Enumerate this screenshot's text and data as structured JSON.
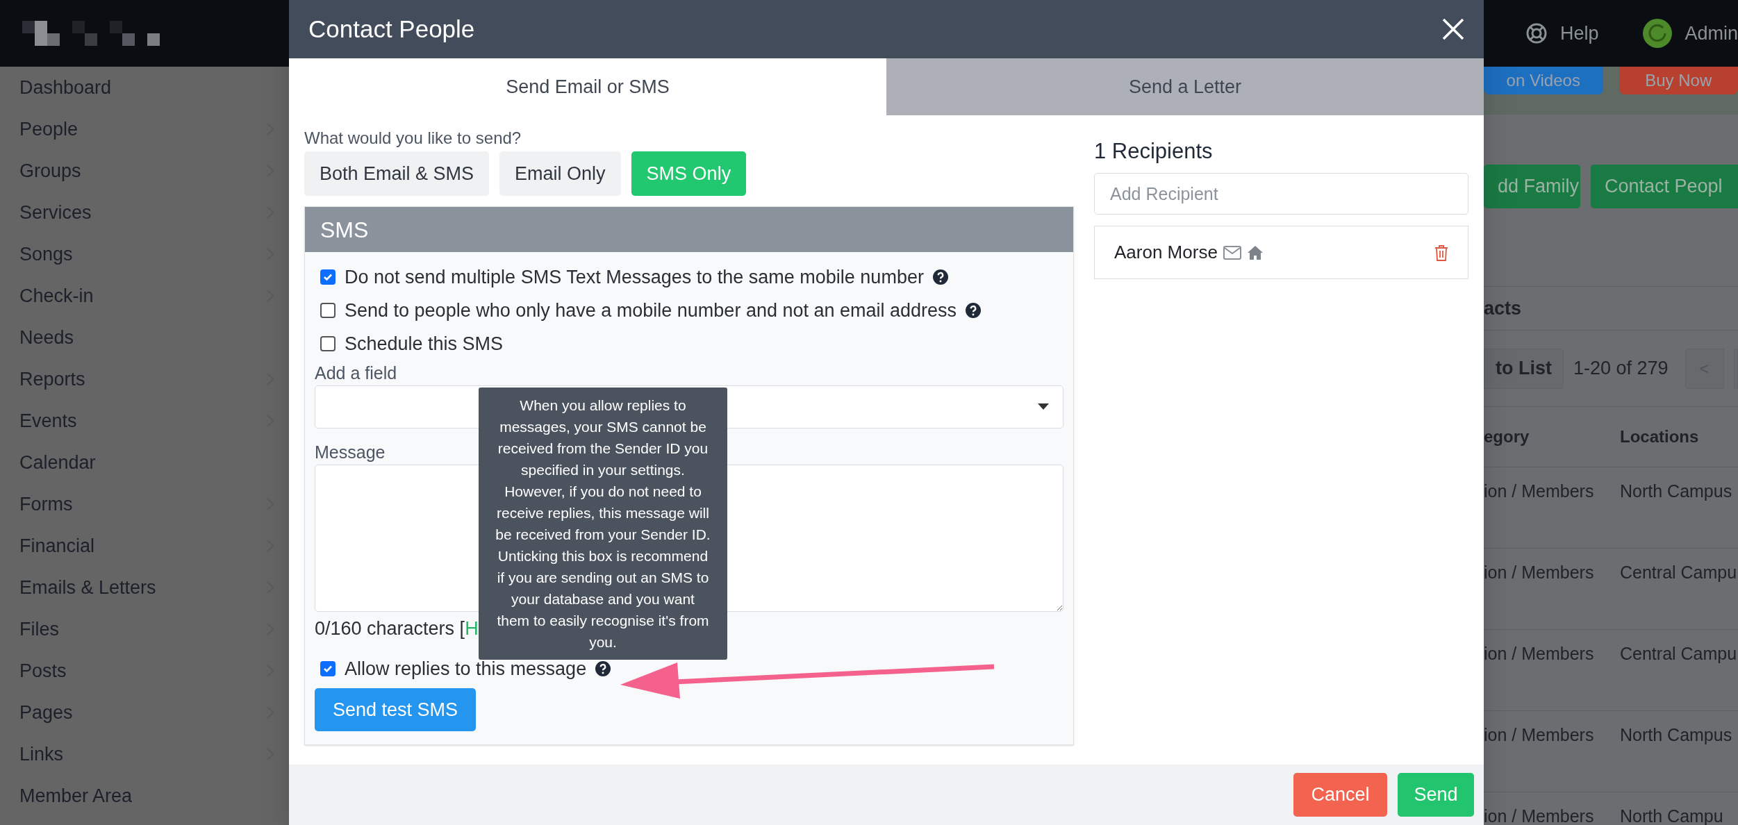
{
  "top_bar": {
    "help": "Help",
    "user": "Admin"
  },
  "sidebar": {
    "items": [
      {
        "label": "Dashboard",
        "expandable": false
      },
      {
        "label": "People",
        "expandable": true
      },
      {
        "label": "Groups",
        "expandable": true
      },
      {
        "label": "Services",
        "expandable": true
      },
      {
        "label": "Songs",
        "expandable": true
      },
      {
        "label": "Check-in",
        "expandable": true
      },
      {
        "label": "Needs",
        "expandable": false
      },
      {
        "label": "Reports",
        "expandable": true
      },
      {
        "label": "Events",
        "expandable": true
      },
      {
        "label": "Calendar",
        "expandable": false
      },
      {
        "label": "Forms",
        "expandable": true
      },
      {
        "label": "Financial",
        "expandable": true
      },
      {
        "label": "Emails & Letters",
        "expandable": true
      },
      {
        "label": "Files",
        "expandable": true
      },
      {
        "label": "Posts",
        "expandable": true
      },
      {
        "label": "Pages",
        "expandable": true
      },
      {
        "label": "Links",
        "expandable": true
      },
      {
        "label": "Member Area",
        "expandable": false
      }
    ]
  },
  "page": {
    "header_buttons": [
      {
        "label": "on Videos",
        "kind": "info"
      },
      {
        "label": "Buy Now",
        "kind": "danger"
      }
    ],
    "action_buttons": [
      "dd Family",
      "Contact Peopl"
    ],
    "section_title": "acts",
    "list_button": "to List",
    "pagination": {
      "range": "1-20 of 279",
      "prev": "<"
    },
    "table": {
      "columns": [
        "egory",
        "Locations"
      ],
      "rows": [
        [
          "ion / Members",
          "North Campus"
        ],
        [
          "ion / Members",
          "Central Campu"
        ],
        [
          "ion / Members",
          "Central Campu"
        ],
        [
          "ion / Members",
          "North Campus"
        ],
        [
          "ion / Members",
          "North Campu"
        ]
      ]
    }
  },
  "modal": {
    "title": "Contact People",
    "tabs": [
      {
        "label": "Send Email or SMS",
        "selected": true
      },
      {
        "label": "Send a Letter",
        "selected": false
      }
    ],
    "send_prompt": "What would you like to send?",
    "send_options": [
      {
        "label": "Both Email & SMS",
        "selected": false
      },
      {
        "label": "Email Only",
        "selected": false
      },
      {
        "label": "SMS Only",
        "selected": true
      }
    ],
    "sms_panel": {
      "title": "SMS",
      "options": [
        {
          "label": "Do not send multiple SMS Text Messages to the same mobile number",
          "checked": true,
          "help": true
        },
        {
          "label": "Send to people who only have a mobile number and not an email address",
          "checked": false,
          "help": true
        },
        {
          "label": "Schedule this SMS",
          "checked": false,
          "help": false
        }
      ],
      "field_label": "Add a field",
      "message_label": "Message",
      "char_count": {
        "before": "0/160 characters [",
        "link": "H"
      },
      "allow_replies": {
        "label": "Allow replies to this message",
        "checked": true
      },
      "test_button": "Send test SMS"
    },
    "tooltip": "When you allow replies to messages, your SMS cannot be received from the Sender ID you specified in your settings. However, if you do not need to receive replies, this message will be received from your Sender ID. Unticking this box is recommend if you are sending out an SMS to your database and you want them to easily recognise it's from you.",
    "recipients": {
      "title": "1 Recipients",
      "placeholder": "Add Recipient",
      "list": [
        {
          "name": "Aaron Morse"
        }
      ]
    },
    "footer_buttons": [
      {
        "label": "Cancel",
        "kind": "cancel"
      },
      {
        "label": "Send",
        "kind": "confirm"
      }
    ]
  }
}
